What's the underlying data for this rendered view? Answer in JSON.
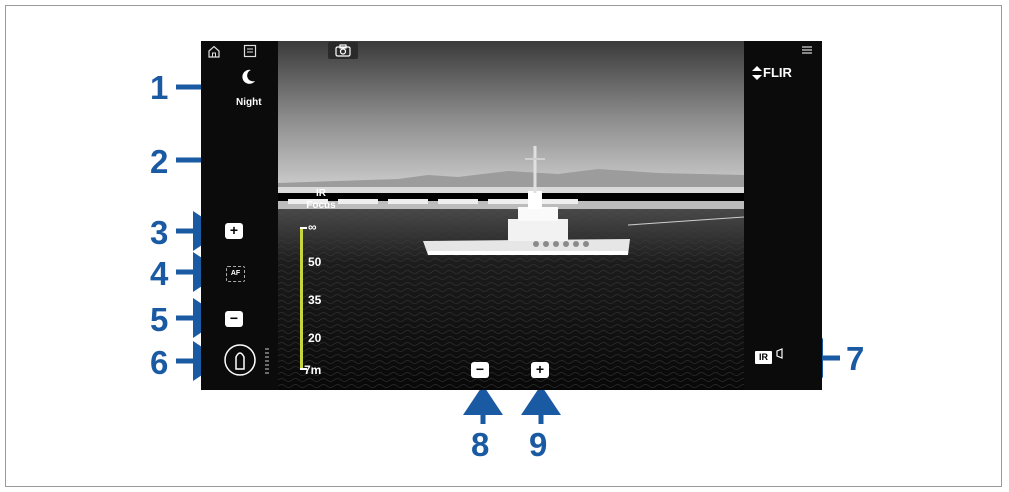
{
  "left": {
    "mode_label": "Night",
    "focus_label_line1": "IR",
    "focus_label_line2": "Focus",
    "zoom_in": "+",
    "autofocus": "AF",
    "zoom_out": "−"
  },
  "focus_scale": [
    "∞",
    "50",
    "35",
    "20",
    "7m"
  ],
  "right": {
    "brand": "FLIR",
    "ir_badge": "IR"
  },
  "bottom": {
    "minus": "−",
    "plus": "+"
  },
  "callouts": [
    "1",
    "2",
    "3",
    "4",
    "5",
    "6",
    "7",
    "8",
    "9"
  ],
  "colors": {
    "callout_blue": "#1a5aa3",
    "focus_bar": "#c7d63c"
  }
}
